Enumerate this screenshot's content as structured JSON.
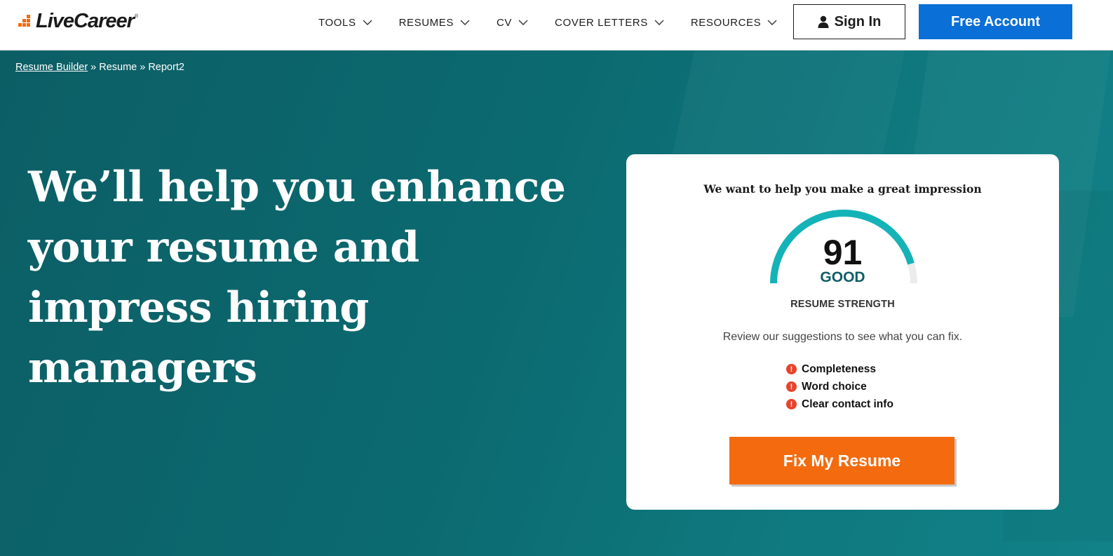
{
  "header": {
    "logo_text": "LiveCareer",
    "logo_reg": "®",
    "nav": [
      {
        "label": "TOOLS"
      },
      {
        "label": "RESUMES"
      },
      {
        "label": "CV"
      },
      {
        "label": "COVER LETTERS"
      },
      {
        "label": "RESOURCES"
      }
    ],
    "signin_label": "Sign In",
    "free_account_label": "Free Account"
  },
  "breadcrumb": {
    "items": [
      "Resume Builder",
      "Resume",
      "Report2"
    ],
    "separator": "»"
  },
  "hero": {
    "title": "We’ll help you enhance your resume and impress hiring managers"
  },
  "card": {
    "title": "We want to help you make a great impression",
    "score": "91",
    "score_value": 91,
    "score_max": 100,
    "grade": "GOOD",
    "strength_label": "RESUME STRENGTH",
    "review_text": "Review our suggestions to see what you can fix.",
    "issues": [
      "Completeness",
      "Word choice",
      "Clear contact info"
    ],
    "warn_glyph": "!",
    "cta_label": "Fix My Resume"
  },
  "colors": {
    "brand_orange": "#f36b11",
    "primary_blue": "#0a6fd6",
    "hero_teal": "#0b6a70",
    "gauge_teal": "#14b3b8",
    "gauge_track": "#ececec",
    "warn_red": "#e8432b"
  },
  "icons": {
    "signin": "user-icon",
    "nav_dropdown": "chevron-down-icon",
    "issue": "warning-icon"
  }
}
